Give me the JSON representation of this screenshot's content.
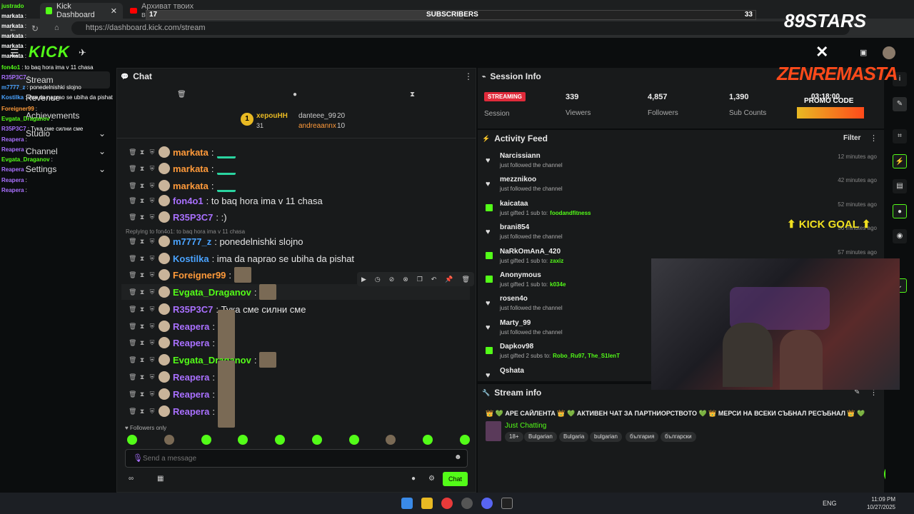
{
  "browser": {
    "tab1": "Kick Dashboard",
    "tab2": "Архиват твоих видео - You",
    "url": "https://dashboard.kick.com/stream"
  },
  "subscribers": {
    "label": "SUBSCRIBERS",
    "current": "17",
    "goal": "33",
    "progress": 0.52
  },
  "brand": {
    "logo": "KICK"
  },
  "sidebar": {
    "items": [
      {
        "label": "Stream"
      },
      {
        "label": "Revenue"
      },
      {
        "label": "Achievements"
      },
      {
        "label": "Studio"
      },
      {
        "label": "Channel"
      },
      {
        "label": "Settings"
      }
    ]
  },
  "overlay_chat": [
    {
      "user": "justrado",
      "msg": "",
      "color": "#53fc18"
    },
    {
      "user": "markata",
      "msg": ":",
      "color": "#ffffff"
    },
    {
      "user": "markata",
      "msg": ":",
      "color": "#ffffff"
    },
    {
      "user": "markata",
      "msg": ":",
      "color": "#ffffff"
    },
    {
      "user": "markata",
      "msg": ":",
      "color": "#ffffff"
    },
    {
      "user": "markata",
      "msg": ":",
      "color": "#ffffff"
    },
    {
      "user": "fon4o1",
      "msg": ": to baq hora ima v 11 chasa",
      "color": "#53fc18"
    },
    {
      "user": "R35P3C7",
      "msg": ":",
      "color": "#a970ff"
    },
    {
      "user": "m7777_z",
      "msg": ": ponedelnishki slojno",
      "color": "#4aa3ff"
    },
    {
      "user": "Kostilka",
      "msg": ": ima da naprao se ubiha da pishat",
      "color": "#4aa3ff"
    },
    {
      "user": "Foreigner99",
      "msg": ":",
      "color": "#ff9a3a"
    },
    {
      "user": "Evgata_Draganov",
      "msg": ":",
      "color": "#53fc18"
    },
    {
      "user": "R35P3C7",
      "msg": ": Тука сме силни сме",
      "color": "#a970ff"
    },
    {
      "user": "Reapera",
      "msg": ":",
      "color": "#a970ff"
    },
    {
      "user": "Reapera",
      "msg": ":",
      "color": "#a970ff"
    },
    {
      "user": "Evgata_Draganov",
      "msg": ":",
      "color": "#53fc18"
    },
    {
      "user": "Reapera",
      "msg": ":",
      "color": "#a970ff"
    },
    {
      "user": "Reapera",
      "msg": ":",
      "color": "#a970ff"
    },
    {
      "user": "Reapera",
      "msg": ":",
      "color": "#a970ff"
    }
  ],
  "chat": {
    "title": "Chat",
    "leaderboard": {
      "rank": "1",
      "first_user": "xepouHH",
      "first_count": "31",
      "second_user": "danteee_99",
      "second_count": "20",
      "third_user": "andreaannx",
      "third_count": "10"
    },
    "reply_note": "Replying to fon4o1: to baq hora ima v 11 chasa",
    "messages": [
      {
        "user": "markata",
        "text": ":",
        "color": "#ff9a3a"
      },
      {
        "user": "markata",
        "text": ":",
        "color": "#ff9a3a"
      },
      {
        "user": "markata",
        "text": ":",
        "color": "#ff9a3a"
      },
      {
        "user": "fon4o1",
        "text": ": to baq hora ima v 11 chasa",
        "color": "#a970ff"
      },
      {
        "user": "R35P3C7",
        "text": ": :)",
        "color": "#a970ff"
      },
      {
        "user": "m7777_z",
        "text": ": ponedelnishki slojno",
        "color": "#4aa3ff"
      },
      {
        "user": "Kostilka",
        "text": ": ima da naprao se ubiha da pishat",
        "color": "#4aa3ff"
      },
      {
        "user": "Foreigner99",
        "text": ":",
        "color": "#ff9a3a"
      },
      {
        "user": "Evgata_Draganov",
        "text": ":",
        "color": "#53fc18"
      },
      {
        "user": "R35P3C7",
        "text": ": Тука сме силни сме",
        "color": "#a970ff"
      },
      {
        "user": "Reapera",
        "text": ":",
        "color": "#a970ff"
      },
      {
        "user": "Reapera",
        "text": ":",
        "color": "#a970ff"
      },
      {
        "user": "Evgata_Draganov",
        "text": ":",
        "color": "#53fc18"
      },
      {
        "user": "Reapera",
        "text": ":",
        "color": "#a970ff"
      },
      {
        "user": "Reapera",
        "text": ":",
        "color": "#a970ff"
      },
      {
        "user": "Reapera",
        "text": ":",
        "color": "#a970ff"
      }
    ],
    "followers_only": "Followers only",
    "input_placeholder": "Send a message",
    "send_label": "Chat"
  },
  "session": {
    "title": "Session Info",
    "status": "STREAMING",
    "session_label": "Session",
    "viewers": "339",
    "viewers_label": "Viewers",
    "followers": "4,857",
    "followers_label": "Followers",
    "subs": "1,390",
    "subs_label": "Sub Counts",
    "uptime": "03:18:00"
  },
  "activity": {
    "title": "Activity Feed",
    "filter": "Filter",
    "items": [
      {
        "kind": "follow",
        "user": "Narcissiann",
        "desc": "just followed the channel",
        "time": "12 minutes ago"
      },
      {
        "kind": "follow",
        "user": "mezznikoo",
        "desc": "just followed the channel",
        "time": "42 minutes ago"
      },
      {
        "kind": "gift",
        "user": "kaicataa",
        "desc": "just gifted 1 sub to:",
        "target": "foodandfitness",
        "time": "52 minutes ago"
      },
      {
        "kind": "follow",
        "user": "brani854",
        "desc": "just followed the channel",
        "time": "56 minutes ago"
      },
      {
        "kind": "gift",
        "user": "NaRkOmAnA_420",
        "desc": "just gifted 1 sub to:",
        "target": "zaxiz",
        "time": "57 minutes ago"
      },
      {
        "kind": "gift",
        "user": "Anonymous",
        "desc": "just gifted 1 sub to:",
        "target": "k034e",
        "time": ""
      },
      {
        "kind": "follow",
        "user": "rosen4o",
        "desc": "just followed the channel",
        "time": ""
      },
      {
        "kind": "follow",
        "user": "Marty_99",
        "desc": "just followed the channel",
        "time": ""
      },
      {
        "kind": "gift",
        "user": "Dapkov98",
        "desc": "just gifted 2 subs to:",
        "target": "Robo_Ru97, The_S1lenT",
        "time": ""
      },
      {
        "kind": "follow",
        "user": "Qshata",
        "desc": "",
        "time": ""
      }
    ]
  },
  "stream_info": {
    "title": "Stream info",
    "stream_title": "👑 💚 АРЕ САЙЛЕНТА 👑 💚 АКТИВЕН ЧАТ ЗА ПАРТНИОРСТВОТО 💚 👑 МЕРСИ НА ВСЕКИ СЪБНАЛ РЕСЪБНАЛ 👑 💚",
    "category": "Just Chatting",
    "tags": [
      "18+",
      "Bulgarian",
      "Bulgaria",
      "bulgarian",
      "българия",
      "български"
    ]
  },
  "overlay": {
    "stars": "89STARS",
    "zen": "ZENREMASTA",
    "promo": "PROMO CODE",
    "kick_goal": "KICK GOAL"
  },
  "taskbar": {
    "lang": "ENG",
    "time": "11:09 PM",
    "date": "10/27/2025"
  }
}
